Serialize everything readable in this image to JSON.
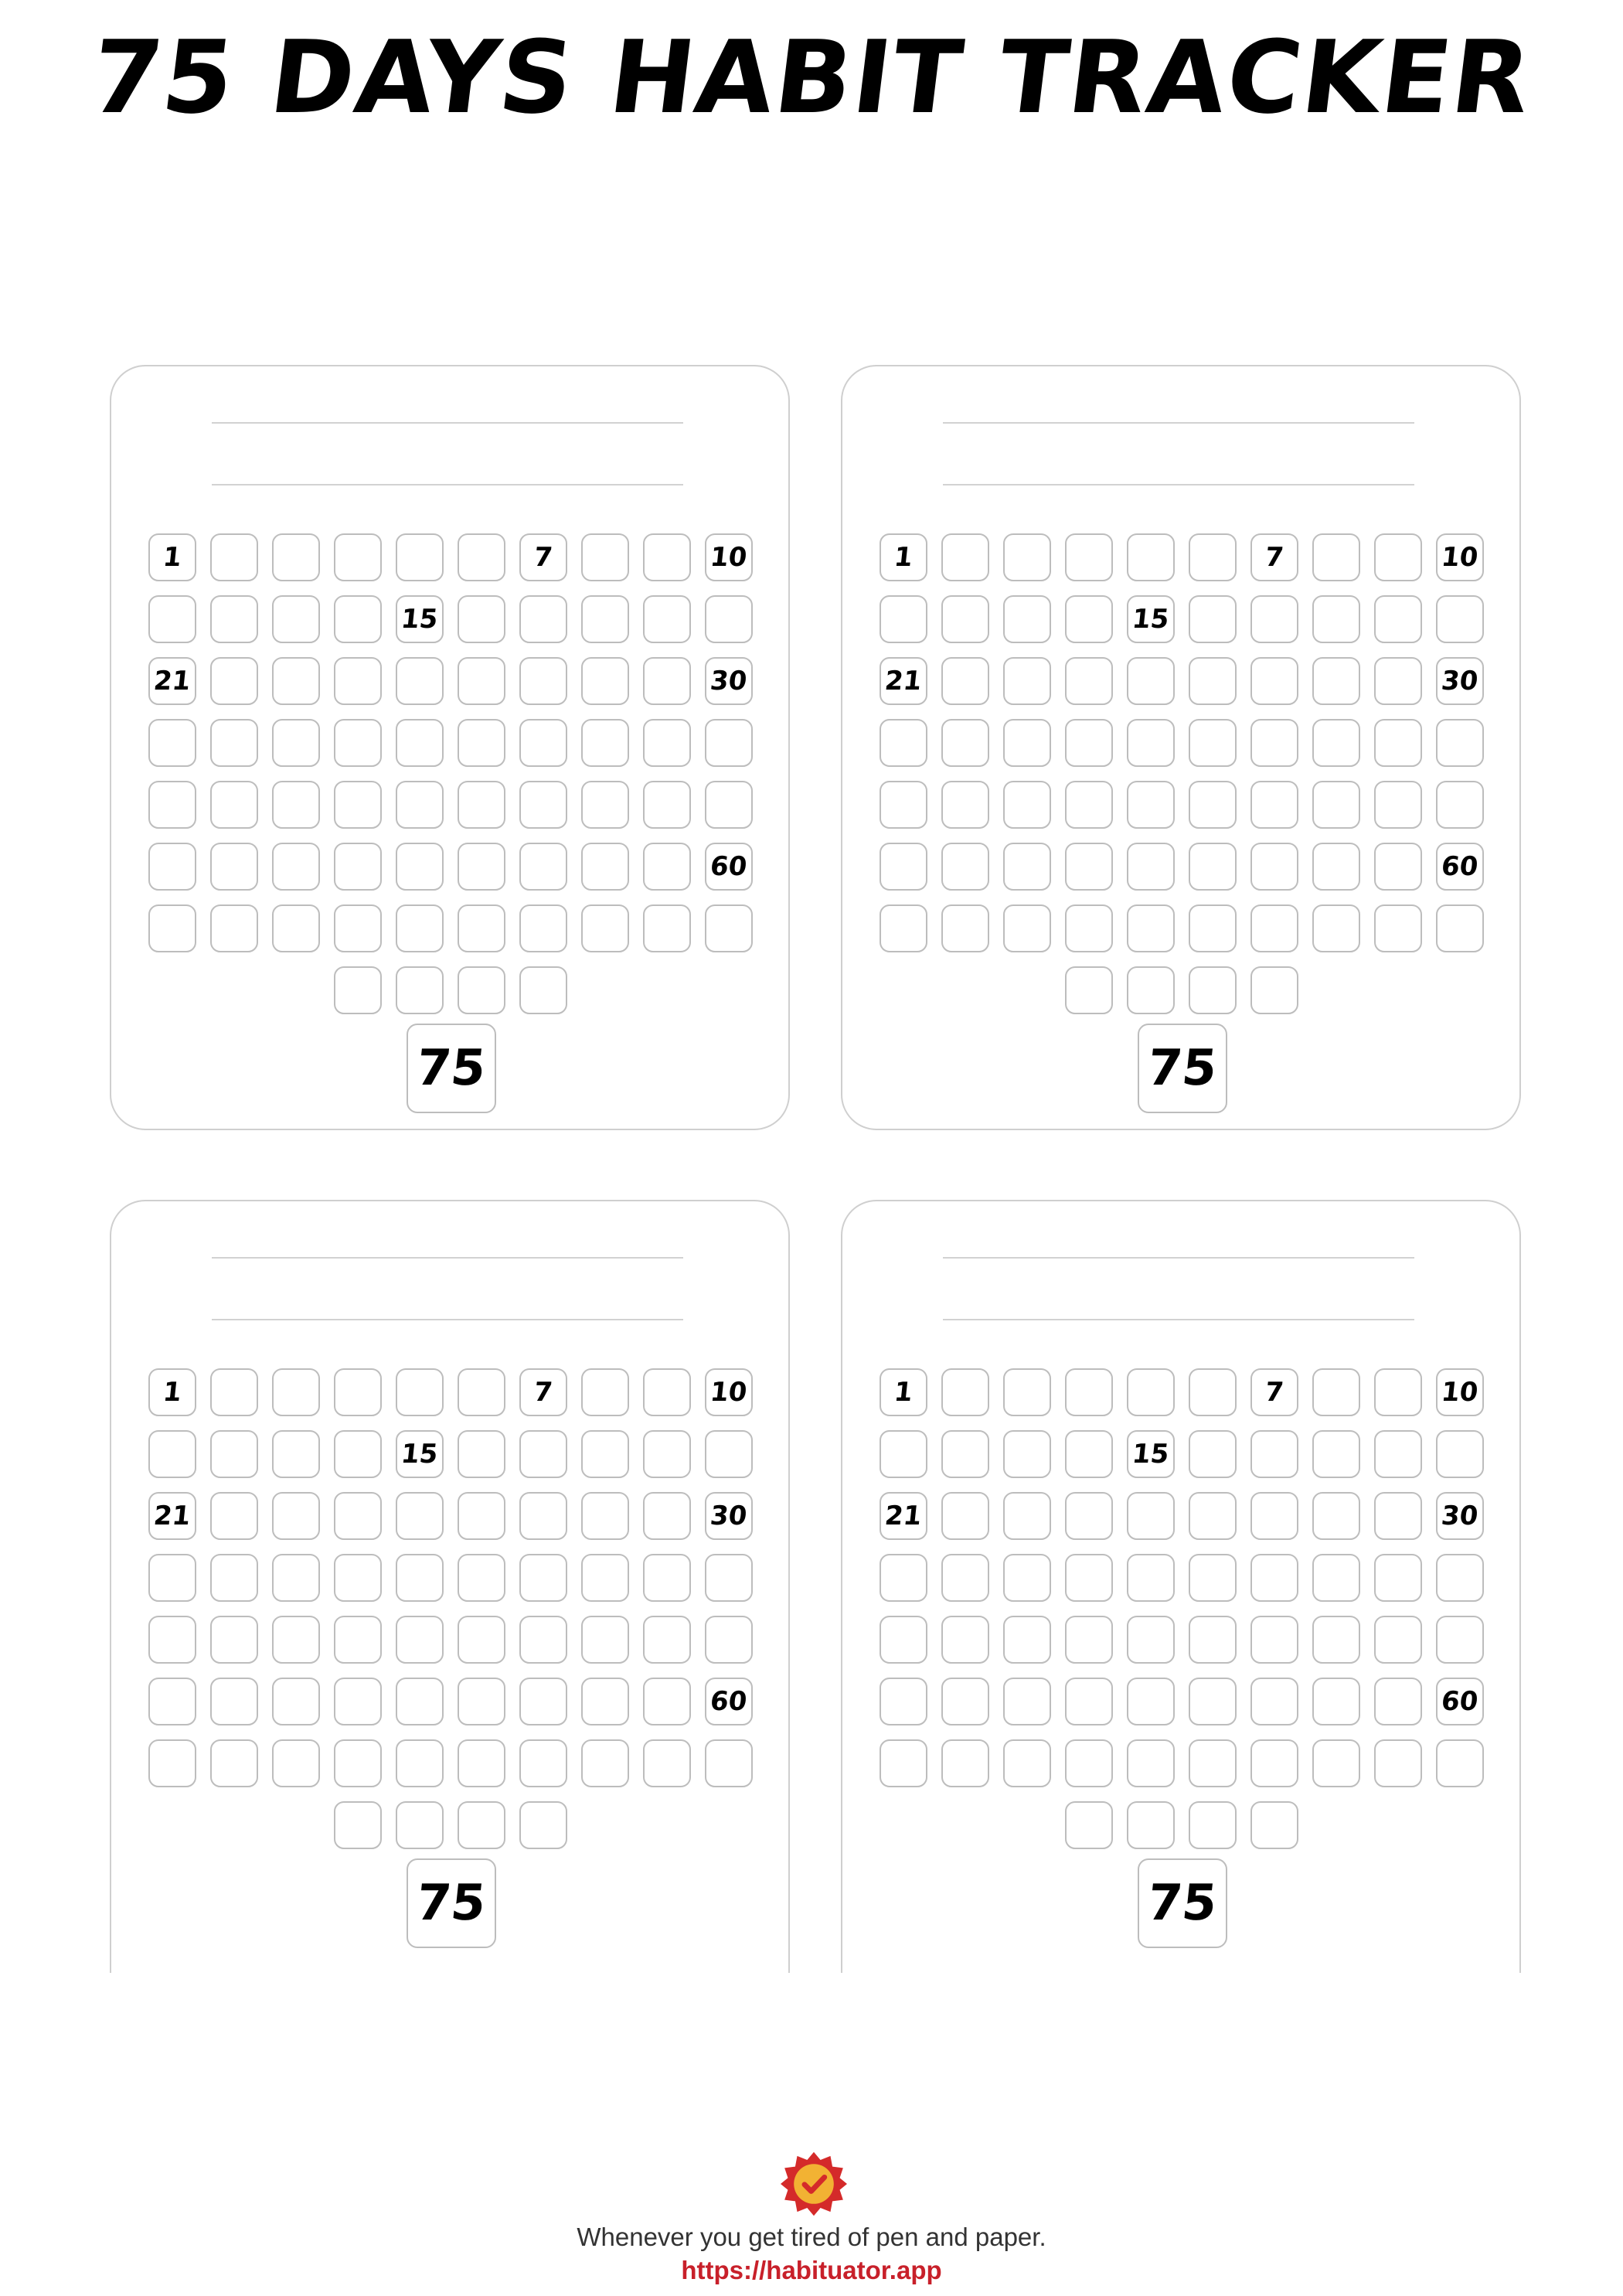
{
  "title": "75 DAYS HABIT TRACKER",
  "trackers": [
    {
      "id": 1,
      "labels": {
        "1": "1",
        "7": "7",
        "10": "10",
        "15": "15",
        "21": "21",
        "30": "30",
        "60": "60"
      },
      "final_label": "75"
    },
    {
      "id": 2,
      "labels": {
        "1": "1",
        "7": "7",
        "10": "10",
        "15": "15",
        "21": "21",
        "30": "30",
        "60": "60"
      },
      "final_label": "75"
    },
    {
      "id": 3,
      "labels": {
        "1": "1",
        "7": "7",
        "10": "10",
        "15": "15",
        "21": "21",
        "30": "30",
        "60": "60"
      },
      "final_label": "75"
    },
    {
      "id": 4,
      "labels": {
        "1": "1",
        "7": "7",
        "10": "10",
        "15": "15",
        "21": "21",
        "30": "30",
        "60": "60"
      },
      "final_label": "75"
    }
  ],
  "footer": {
    "logo_icon": "checkmark-badge-icon",
    "tagline": "Whenever you get tired of pen and paper.",
    "url": "https://habituator.app"
  },
  "colors": {
    "url": "#c8202a",
    "badge": "#d42a2a",
    "badge_center": "#f2b233"
  }
}
